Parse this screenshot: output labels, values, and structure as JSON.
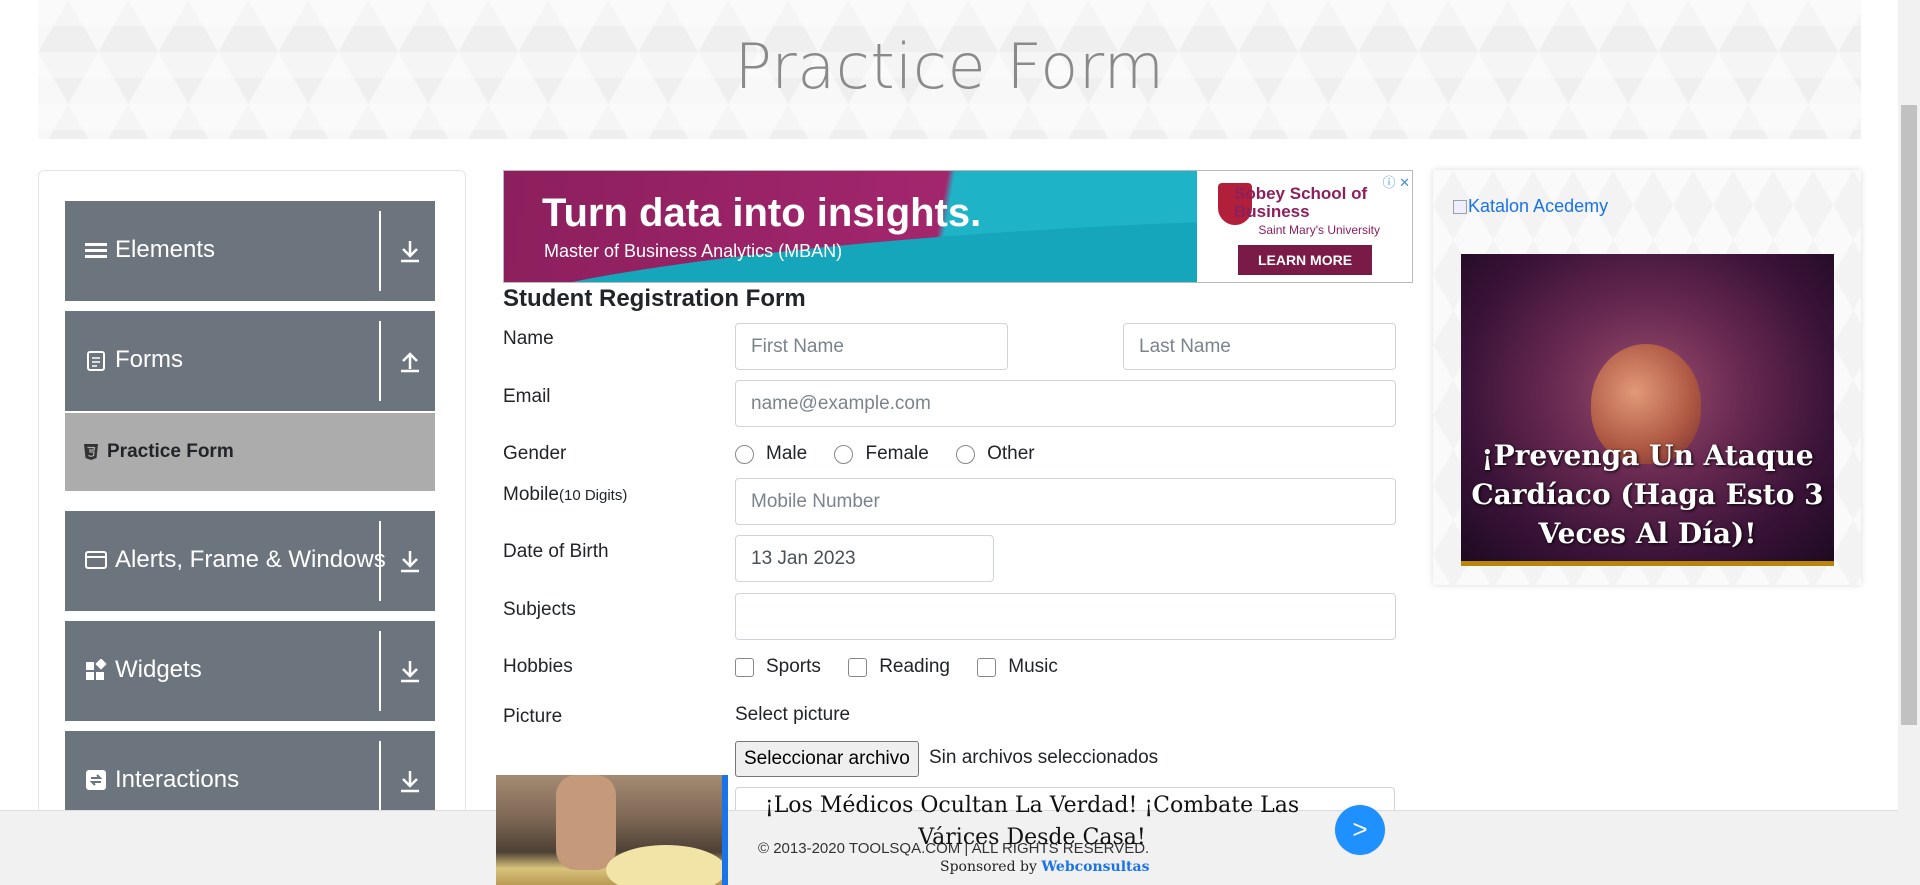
{
  "header": {
    "title": "Practice Form"
  },
  "sidebar": {
    "groups": [
      {
        "label": "Elements",
        "icon": "menu-icon",
        "arrow": "download-arrow-icon"
      },
      {
        "label": "Forms",
        "icon": "document-icon",
        "arrow": "upload-arrow-icon"
      },
      {
        "label": "Alerts, Frame & Windows",
        "icon": "window-icon",
        "arrow": "download-arrow-icon"
      },
      {
        "label": "Widgets",
        "icon": "widgets-icon",
        "arrow": "download-arrow-icon"
      },
      {
        "label": "Interactions",
        "icon": "interactions-icon",
        "arrow": "download-arrow-icon"
      }
    ],
    "active_item": {
      "label": "Practice Form",
      "icon": "html5-icon"
    }
  },
  "top_ad": {
    "headline": "Turn data into insights.",
    "subline": "Master of Business Analytics (MBAN)",
    "school": "Sobey School of Business",
    "university": "Saint Mary's University",
    "cta": "LEARN MORE"
  },
  "side_ad": {
    "link_text": "Katalon Acedemy",
    "headline": "¡Prevenga Un Ataque Cardíaco (Haga Esto 3 Veces Al Día)!"
  },
  "form": {
    "title": "Student Registration Form",
    "labels": {
      "name": "Name",
      "email": "Email",
      "gender": "Gender",
      "mobile": "Mobile",
      "mobile_hint": "(10 Digits)",
      "dob": "Date of Birth",
      "subjects": "Subjects",
      "hobbies": "Hobbies",
      "picture": "Picture"
    },
    "placeholders": {
      "first_name": "First Name",
      "last_name": "Last Name",
      "email": "name@example.com",
      "mobile": "Mobile Number"
    },
    "values": {
      "dob": "13 Jan 2023"
    },
    "genders": [
      "Male",
      "Female",
      "Other"
    ],
    "hobbies": [
      "Sports",
      "Reading",
      "Music"
    ],
    "picture": {
      "select_label": "Select picture",
      "button": "Seleccionar archivo",
      "status": "Sin archivos seleccionados"
    }
  },
  "bottom_ad": {
    "text": "¡Los Médicos Ocultan La Verdad! ¡Combate Las Várices Desde Casa!",
    "sponsored_prefix": "Sponsored by",
    "sponsor": "Webconsultas",
    "go": ">"
  },
  "footer": {
    "text": "© 2013-2020 TOOLSQA.COM | ALL RIGHTS RESERVED."
  }
}
